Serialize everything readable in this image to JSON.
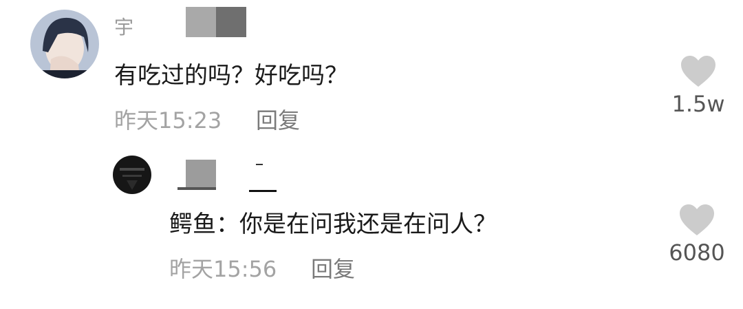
{
  "comments": [
    {
      "username": "宇",
      "text": "有吃过的吗？好吃吗？",
      "time": "昨天15:23",
      "reply_label": "回复",
      "likes": "1.5w",
      "avatar_icon": "user-avatar-photo",
      "like_icon": "heart-icon"
    }
  ],
  "replies": [
    {
      "username": "",
      "text": "鳄鱼：你是在问我还是在问人？",
      "time": "昨天15:56",
      "reply_label": "回复",
      "likes": "6080",
      "avatar_icon": "user-avatar-dark",
      "like_icon": "heart-icon"
    }
  ],
  "colors": {
    "heart": "#cccccc",
    "text": "#1a1a1a",
    "meta": "#a3a3a3"
  }
}
